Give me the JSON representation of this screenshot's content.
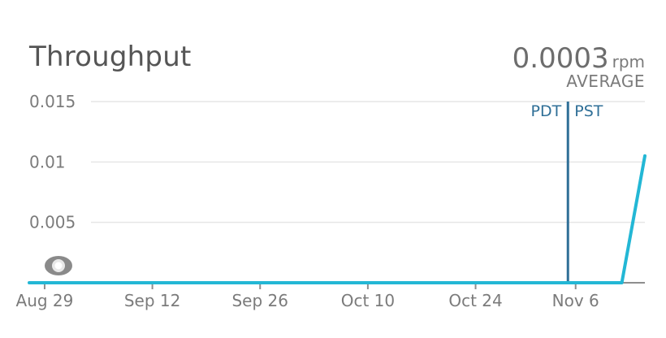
{
  "chart_data": {
    "type": "line",
    "title": "Throughput",
    "summary": {
      "value": "0.0003",
      "unit": "rpm",
      "label": "AVERAGE"
    },
    "ylim": [
      0,
      0.015
    ],
    "yticks": [
      {
        "value": 0.015,
        "label": "0.015"
      },
      {
        "value": 0.01,
        "label": "0.01"
      },
      {
        "value": 0.005,
        "label": "0.005"
      }
    ],
    "xlim": [
      "2023-08-27",
      "2023-11-15"
    ],
    "xticks": [
      {
        "date": "2023-08-29",
        "label": "Aug 29"
      },
      {
        "date": "2023-09-12",
        "label": "Sep 12"
      },
      {
        "date": "2023-09-26",
        "label": "Sep 26"
      },
      {
        "date": "2023-10-10",
        "label": "Oct 10"
      },
      {
        "date": "2023-10-24",
        "label": "Oct 24"
      },
      {
        "date": "2023-11-06",
        "label": "Nov 6"
      }
    ],
    "series": [
      {
        "color": "#23b7d5",
        "points": [
          {
            "x": "2023-08-27",
            "y": 0
          },
          {
            "x": "2023-11-12",
            "y": 0
          },
          {
            "x": "2023-11-15",
            "y": 0.0105
          }
        ]
      }
    ],
    "annotations": [
      {
        "date": "2023-11-05",
        "left_label": "PDT",
        "right_label": "PST",
        "color": "#2f6f97"
      }
    ],
    "grid": true,
    "legend": "none"
  }
}
